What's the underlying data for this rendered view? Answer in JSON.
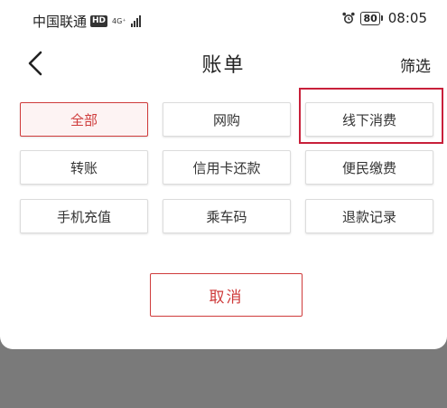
{
  "status_bar": {
    "carrier": "中国联通",
    "hd_badge": "HD",
    "network_type": "4G⁺",
    "battery_level": "80",
    "time": "08:05"
  },
  "nav": {
    "title": "账单",
    "filter_label": "筛选"
  },
  "categories": [
    {
      "label": "全部",
      "selected": true
    },
    {
      "label": "网购",
      "selected": false
    },
    {
      "label": "线下消费",
      "selected": false
    },
    {
      "label": "转账",
      "selected": false
    },
    {
      "label": "信用卡还款",
      "selected": false
    },
    {
      "label": "便民缴费",
      "selected": false
    },
    {
      "label": "手机充值",
      "selected": false
    },
    {
      "label": "乘车码",
      "selected": false
    },
    {
      "label": "退款记录",
      "selected": false
    }
  ],
  "cancel_label": "取消",
  "colors": {
    "accent": "#cf3b3b",
    "highlight": "#c8203a",
    "overlay": "#7a7a7a"
  },
  "icons": {
    "back": "chevron-left-icon",
    "alarm": "alarm-clock-icon",
    "battery": "battery-icon",
    "signal": "signal-icon"
  }
}
